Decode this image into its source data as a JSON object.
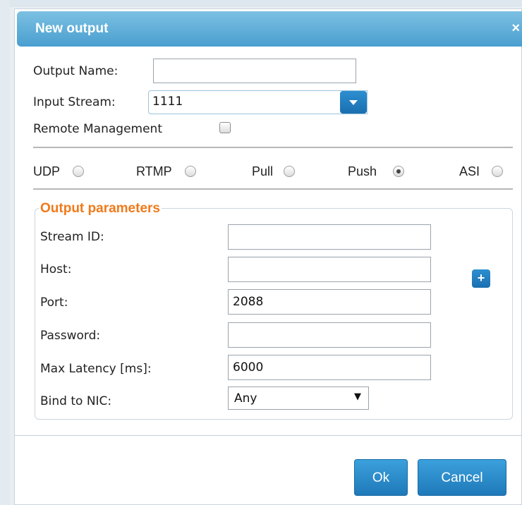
{
  "dialog": {
    "title": "New output",
    "close_label": "×"
  },
  "form": {
    "output_name": {
      "label": "Output Name:",
      "value": ""
    },
    "input_stream": {
      "label": "Input Stream:",
      "value": "1111"
    },
    "remote_management": {
      "label": "Remote Management",
      "checked": false
    }
  },
  "protocols": [
    {
      "label": "UDP",
      "selected": false
    },
    {
      "label": "RTMP",
      "selected": false
    },
    {
      "label": "Pull",
      "selected": false
    },
    {
      "label": "Push",
      "selected": true
    },
    {
      "label": "ASI",
      "selected": false
    }
  ],
  "output_parameters": {
    "legend": "Output parameters",
    "stream_id": {
      "label": "Stream ID:",
      "value": ""
    },
    "host": {
      "label": "Host:",
      "value": ""
    },
    "port": {
      "label": "Port:",
      "value": "2088"
    },
    "password": {
      "label": "Password:",
      "value": ""
    },
    "max_latency": {
      "label": "Max Latency [ms]:",
      "value": "6000"
    },
    "bind_to_nic": {
      "label": "Bind to NIC:",
      "value": "Any"
    },
    "add_host_label": "+"
  },
  "buttons": {
    "ok": "Ok",
    "cancel": "Cancel"
  },
  "icons": {
    "close": "close-icon",
    "dropdown": "chevron-down-icon",
    "add": "plus-icon"
  },
  "colors": {
    "titlebar": "#4a9fd0",
    "accent_button": "#1f79b9",
    "legend_orange": "#f07a1a"
  }
}
